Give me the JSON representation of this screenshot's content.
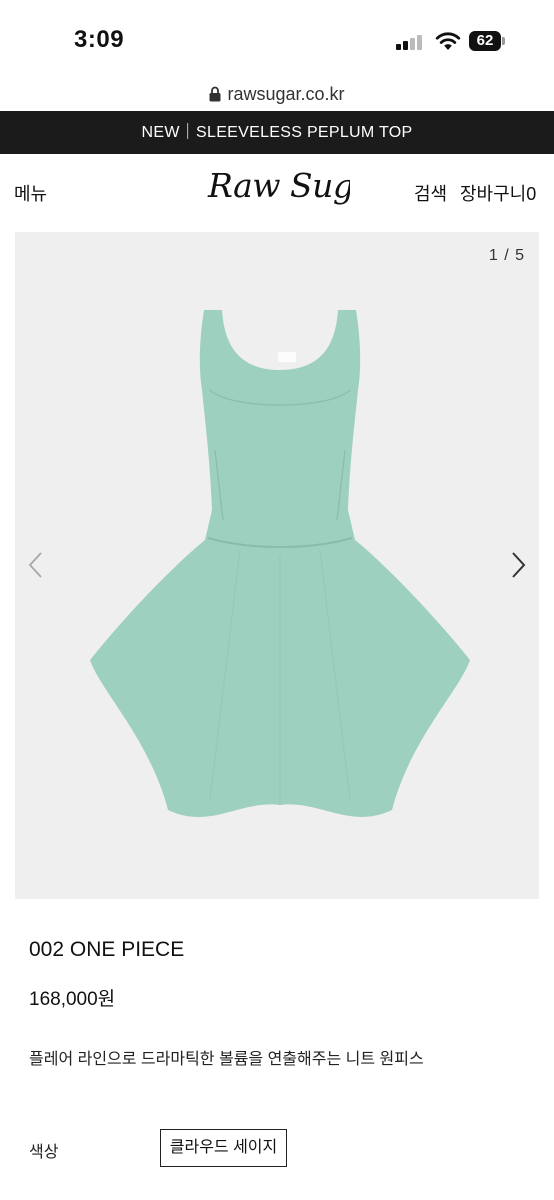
{
  "status_bar": {
    "time": "3:09",
    "battery": "62"
  },
  "browser": {
    "url": "rawsugar.co.kr"
  },
  "banner": {
    "text": "NEW｜SLEEVELESS PEPLUM TOP"
  },
  "header": {
    "menu": "메뉴",
    "logo": "Raw Sugar",
    "search": "검색",
    "cart": "장바구니0"
  },
  "gallery": {
    "counter": "1 / 5"
  },
  "product": {
    "name": "002 ONE PIECE",
    "price": "168,000원",
    "description": "플레어 라인으로 드라마틱한 볼륨을 연출해주는 니트 원피스",
    "color_label": "색상",
    "color_option": "클라우드 세이지",
    "dress_color": "#9ed0bf"
  }
}
